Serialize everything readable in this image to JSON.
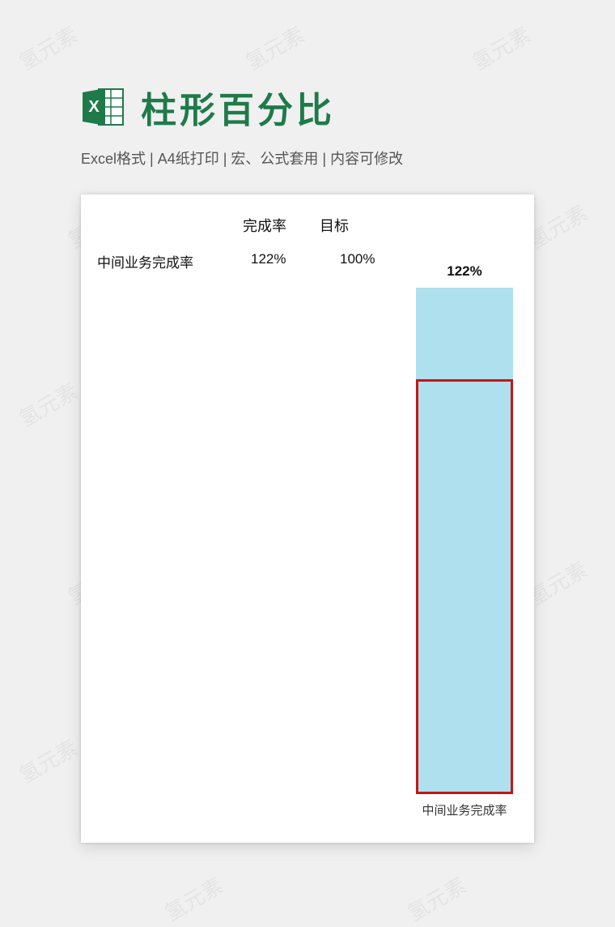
{
  "header": {
    "title": "柱形百分比",
    "subtitle": "Excel格式 |  A4纸打印 | 宏、公式套用 | 内容可修改",
    "icon_name": "excel-icon"
  },
  "watermark_text": "氢元素",
  "table": {
    "col1_header": "完成率",
    "col2_header": "目标",
    "row_label": "中间业务完成率",
    "row_val1": "122%",
    "row_val2": "100%"
  },
  "chart_data": {
    "type": "bar",
    "categories": [
      "中间业务完成率"
    ],
    "series": [
      {
        "name": "完成率",
        "values": [
          122
        ]
      },
      {
        "name": "目标",
        "values": [
          100
        ]
      }
    ],
    "value_label": "122%",
    "x_category_label": "中间业务完成率",
    "ylim": [
      0,
      122
    ],
    "colors": {
      "fill": "#aee0ee",
      "target_border": "#c81414"
    }
  }
}
